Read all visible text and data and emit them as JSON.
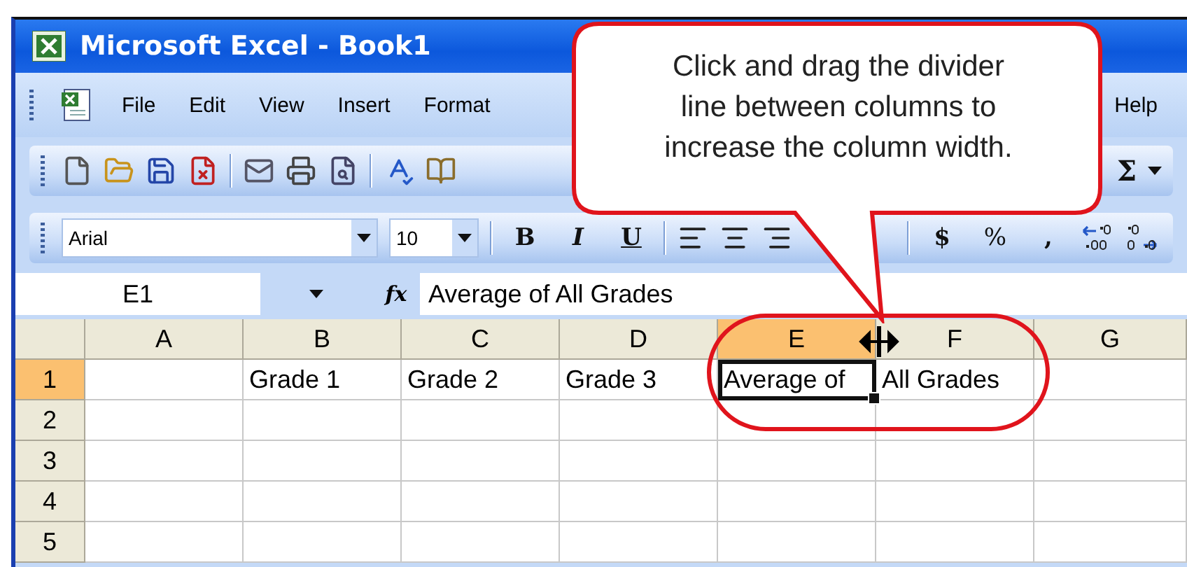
{
  "window": {
    "title": "Microsoft Excel - Book1"
  },
  "menu": {
    "items": [
      {
        "label": "File"
      },
      {
        "label": "Edit"
      },
      {
        "label": "View"
      },
      {
        "label": "Insert"
      },
      {
        "label": "Format"
      },
      {
        "label": "Help"
      }
    ]
  },
  "standard_toolbar": {
    "items": [
      {
        "kind": "new"
      },
      {
        "kind": "open"
      },
      {
        "kind": "save"
      },
      {
        "kind": "permission"
      },
      {
        "kind": "separator"
      },
      {
        "kind": "email"
      },
      {
        "kind": "print"
      },
      {
        "kind": "preview"
      },
      {
        "kind": "separator"
      },
      {
        "kind": "spelling"
      },
      {
        "kind": "research"
      }
    ],
    "autosum": "Σ"
  },
  "formatting_toolbar": {
    "font": "Arial",
    "size": "10",
    "items": [
      {
        "kind": "bold",
        "label": "B"
      },
      {
        "kind": "italic",
        "label": "I"
      },
      {
        "kind": "underline",
        "label": "U"
      },
      {
        "kind": "separator"
      },
      {
        "kind": "align-left"
      },
      {
        "kind": "align-center"
      },
      {
        "kind": "align-right"
      },
      {
        "kind": "gap"
      },
      {
        "kind": "separator"
      },
      {
        "kind": "currency",
        "label": "$"
      },
      {
        "kind": "percent",
        "label": "%"
      },
      {
        "kind": "comma",
        "label": ","
      },
      {
        "kind": "increase-decimal"
      },
      {
        "kind": "decrease-decimal"
      }
    ]
  },
  "formula_bar": {
    "name_box": "E1",
    "fx": "fx",
    "formula": "Average of All Grades"
  },
  "sheet": {
    "columns": [
      {
        "label": "A",
        "selected": false
      },
      {
        "label": "B",
        "selected": false
      },
      {
        "label": "C",
        "selected": false
      },
      {
        "label": "D",
        "selected": false
      },
      {
        "label": "E",
        "selected": true
      },
      {
        "label": "F",
        "selected": false
      },
      {
        "label": "G",
        "selected": false
      }
    ],
    "rows": [
      {
        "label": "1",
        "selected": true,
        "cells": [
          {
            "selected": false
          },
          {
            "text": "Grade 1",
            "selected": false
          },
          {
            "text": "Grade 2",
            "selected": false
          },
          {
            "text": "Grade 3",
            "selected": false
          },
          {
            "text": "Average of",
            "selected": true
          },
          {
            "text": "All Grades",
            "selected": false
          },
          {
            "selected": false
          }
        ]
      },
      {
        "label": "2",
        "selected": false
      },
      {
        "label": "3",
        "selected": false
      },
      {
        "label": "4",
        "selected": false
      },
      {
        "label": "5",
        "selected": false
      }
    ]
  },
  "callout": {
    "text": "Click and drag the divider line between columns to increase the column width."
  }
}
